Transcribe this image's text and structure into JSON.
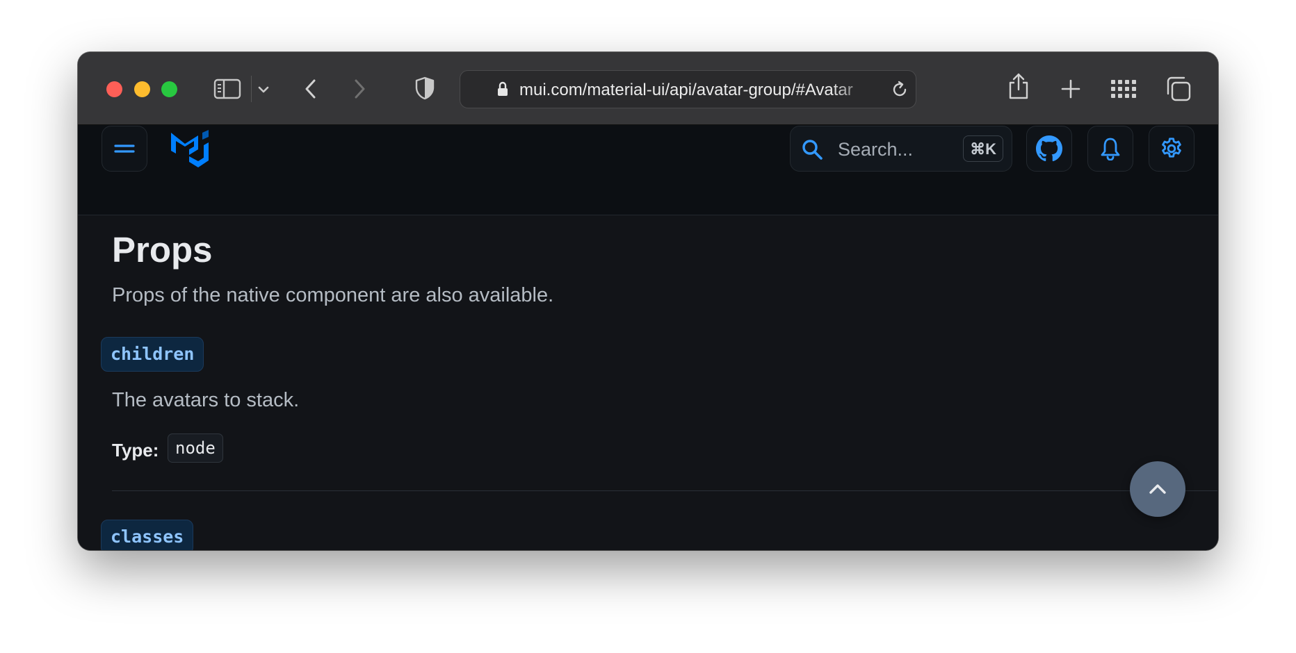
{
  "browser": {
    "url": "mui.com/material-ui/api/avatar-group/#Avatar",
    "icons": [
      "sidebar-icon",
      "chevron-down-icon",
      "back-icon",
      "forward-icon",
      "privacy-shield-icon",
      "lock-icon",
      "reload-icon",
      "share-icon",
      "new-tab-icon",
      "grid-icon",
      "tabs-overview-icon"
    ]
  },
  "header": {
    "search_placeholder": "Search...",
    "search_shortcut": "⌘K",
    "accent_color": "#3399ff"
  },
  "main": {
    "section_title": "Props",
    "section_description": "Props of the native component are also available.",
    "props": [
      {
        "name": "children",
        "description": "The avatars to stack.",
        "type_label": "Type:",
        "type_value": "node"
      },
      {
        "name": "classes"
      }
    ]
  }
}
